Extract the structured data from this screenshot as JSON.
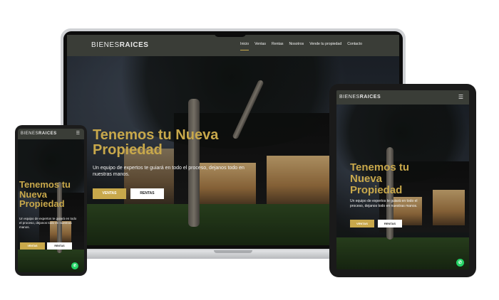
{
  "brand": {
    "light": "BIENES",
    "bold": "RAICES"
  },
  "nav": {
    "items": [
      "Inicio",
      "Ventas",
      "Rentas",
      "Nosotros",
      "Vende tu propiedad",
      "Contacto"
    ],
    "active": "Inicio"
  },
  "hero": {
    "title": "Tenemos tu Nueva Propiedad",
    "subtitle": "Un equipo de expertos te guiará en todo el proceso, dejanos todo en nuestras manos.",
    "btn_primary": "VENTAS",
    "btn_secondary": "RENTAS"
  },
  "icons": {
    "menu": "hamburger-menu-icon",
    "whatsapp": "whatsapp-icon"
  },
  "colors": {
    "accent": "#c8a84b",
    "nav_bg": "#3a3d37",
    "whatsapp": "#25d366"
  }
}
